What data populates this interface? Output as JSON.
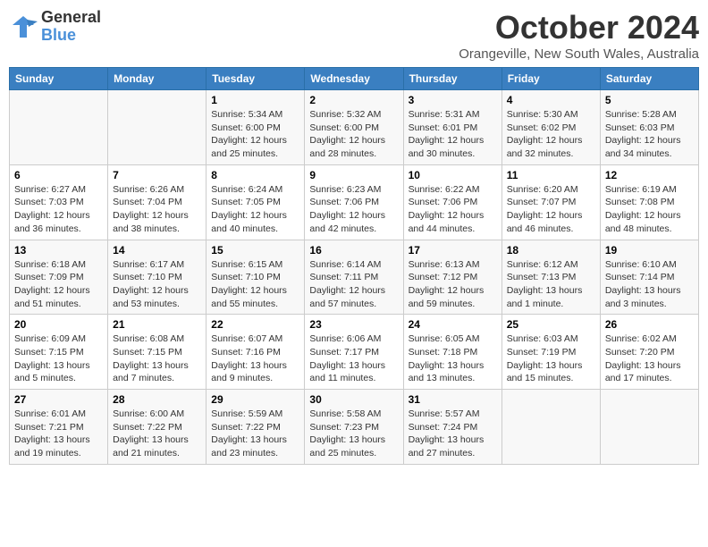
{
  "header": {
    "logo_line1": "General",
    "logo_line2": "Blue",
    "month": "October 2024",
    "location": "Orangeville, New South Wales, Australia"
  },
  "weekdays": [
    "Sunday",
    "Monday",
    "Tuesday",
    "Wednesday",
    "Thursday",
    "Friday",
    "Saturday"
  ],
  "weeks": [
    [
      {
        "day": "",
        "info": ""
      },
      {
        "day": "",
        "info": ""
      },
      {
        "day": "1",
        "info": "Sunrise: 5:34 AM\nSunset: 6:00 PM\nDaylight: 12 hours\nand 25 minutes."
      },
      {
        "day": "2",
        "info": "Sunrise: 5:32 AM\nSunset: 6:00 PM\nDaylight: 12 hours\nand 28 minutes."
      },
      {
        "day": "3",
        "info": "Sunrise: 5:31 AM\nSunset: 6:01 PM\nDaylight: 12 hours\nand 30 minutes."
      },
      {
        "day": "4",
        "info": "Sunrise: 5:30 AM\nSunset: 6:02 PM\nDaylight: 12 hours\nand 32 minutes."
      },
      {
        "day": "5",
        "info": "Sunrise: 5:28 AM\nSunset: 6:03 PM\nDaylight: 12 hours\nand 34 minutes."
      }
    ],
    [
      {
        "day": "6",
        "info": "Sunrise: 6:27 AM\nSunset: 7:03 PM\nDaylight: 12 hours\nand 36 minutes."
      },
      {
        "day": "7",
        "info": "Sunrise: 6:26 AM\nSunset: 7:04 PM\nDaylight: 12 hours\nand 38 minutes."
      },
      {
        "day": "8",
        "info": "Sunrise: 6:24 AM\nSunset: 7:05 PM\nDaylight: 12 hours\nand 40 minutes."
      },
      {
        "day": "9",
        "info": "Sunrise: 6:23 AM\nSunset: 7:06 PM\nDaylight: 12 hours\nand 42 minutes."
      },
      {
        "day": "10",
        "info": "Sunrise: 6:22 AM\nSunset: 7:06 PM\nDaylight: 12 hours\nand 44 minutes."
      },
      {
        "day": "11",
        "info": "Sunrise: 6:20 AM\nSunset: 7:07 PM\nDaylight: 12 hours\nand 46 minutes."
      },
      {
        "day": "12",
        "info": "Sunrise: 6:19 AM\nSunset: 7:08 PM\nDaylight: 12 hours\nand 48 minutes."
      }
    ],
    [
      {
        "day": "13",
        "info": "Sunrise: 6:18 AM\nSunset: 7:09 PM\nDaylight: 12 hours\nand 51 minutes."
      },
      {
        "day": "14",
        "info": "Sunrise: 6:17 AM\nSunset: 7:10 PM\nDaylight: 12 hours\nand 53 minutes."
      },
      {
        "day": "15",
        "info": "Sunrise: 6:15 AM\nSunset: 7:10 PM\nDaylight: 12 hours\nand 55 minutes."
      },
      {
        "day": "16",
        "info": "Sunrise: 6:14 AM\nSunset: 7:11 PM\nDaylight: 12 hours\nand 57 minutes."
      },
      {
        "day": "17",
        "info": "Sunrise: 6:13 AM\nSunset: 7:12 PM\nDaylight: 12 hours\nand 59 minutes."
      },
      {
        "day": "18",
        "info": "Sunrise: 6:12 AM\nSunset: 7:13 PM\nDaylight: 13 hours\nand 1 minute."
      },
      {
        "day": "19",
        "info": "Sunrise: 6:10 AM\nSunset: 7:14 PM\nDaylight: 13 hours\nand 3 minutes."
      }
    ],
    [
      {
        "day": "20",
        "info": "Sunrise: 6:09 AM\nSunset: 7:15 PM\nDaylight: 13 hours\nand 5 minutes."
      },
      {
        "day": "21",
        "info": "Sunrise: 6:08 AM\nSunset: 7:15 PM\nDaylight: 13 hours\nand 7 minutes."
      },
      {
        "day": "22",
        "info": "Sunrise: 6:07 AM\nSunset: 7:16 PM\nDaylight: 13 hours\nand 9 minutes."
      },
      {
        "day": "23",
        "info": "Sunrise: 6:06 AM\nSunset: 7:17 PM\nDaylight: 13 hours\nand 11 minutes."
      },
      {
        "day": "24",
        "info": "Sunrise: 6:05 AM\nSunset: 7:18 PM\nDaylight: 13 hours\nand 13 minutes."
      },
      {
        "day": "25",
        "info": "Sunrise: 6:03 AM\nSunset: 7:19 PM\nDaylight: 13 hours\nand 15 minutes."
      },
      {
        "day": "26",
        "info": "Sunrise: 6:02 AM\nSunset: 7:20 PM\nDaylight: 13 hours\nand 17 minutes."
      }
    ],
    [
      {
        "day": "27",
        "info": "Sunrise: 6:01 AM\nSunset: 7:21 PM\nDaylight: 13 hours\nand 19 minutes."
      },
      {
        "day": "28",
        "info": "Sunrise: 6:00 AM\nSunset: 7:22 PM\nDaylight: 13 hours\nand 21 minutes."
      },
      {
        "day": "29",
        "info": "Sunrise: 5:59 AM\nSunset: 7:22 PM\nDaylight: 13 hours\nand 23 minutes."
      },
      {
        "day": "30",
        "info": "Sunrise: 5:58 AM\nSunset: 7:23 PM\nDaylight: 13 hours\nand 25 minutes."
      },
      {
        "day": "31",
        "info": "Sunrise: 5:57 AM\nSunset: 7:24 PM\nDaylight: 13 hours\nand 27 minutes."
      },
      {
        "day": "",
        "info": ""
      },
      {
        "day": "",
        "info": ""
      }
    ]
  ]
}
